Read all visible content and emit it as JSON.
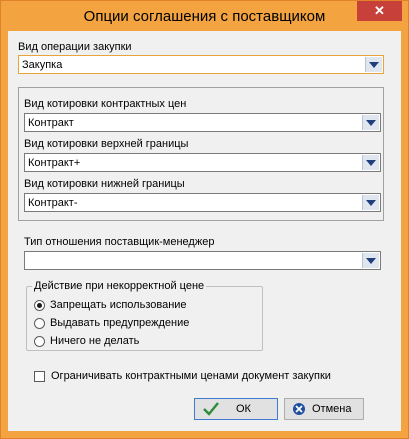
{
  "window": {
    "title": "Опции соглашения с поставщиком",
    "close_symbol": "✕"
  },
  "purchase_op": {
    "label": "Вид операции закупки",
    "value": "Закупка"
  },
  "quote_group": {
    "contract_price": {
      "label": "Вид котировки контрактных цен",
      "value": "Контракт"
    },
    "upper_bound": {
      "label": "Вид котировки верхней границы",
      "value": "Контракт+"
    },
    "lower_bound": {
      "label": "Вид котировки нижней границы",
      "value": "Контракт-"
    }
  },
  "relation": {
    "label": "Тип отношения поставщик-менеджер",
    "value": ""
  },
  "incorrect_price": {
    "legend": "Действие при некорректной цене",
    "options": [
      {
        "label": "Запрещать использование",
        "selected": true
      },
      {
        "label": "Выдавать предупреждение",
        "selected": false
      },
      {
        "label": "Ничего не делать",
        "selected": false
      }
    ]
  },
  "restrict": {
    "label": "Ограничивать контрактными ценами документ закупки",
    "checked": false
  },
  "buttons": {
    "ok_label": "ОК",
    "cancel_label": "Отмена"
  },
  "colors": {
    "titlebar": "#f3a33f",
    "close_button": "#c7403a",
    "ok_icon": "#2e8b3a",
    "cancel_icon": "#1f4fa0",
    "dropdown_arrow": "#1f3f7a"
  },
  "icons": {
    "close": "close-icon",
    "dropdown": "chevron-down-icon",
    "ok": "checkmark-icon",
    "cancel": "cancel-icon"
  }
}
